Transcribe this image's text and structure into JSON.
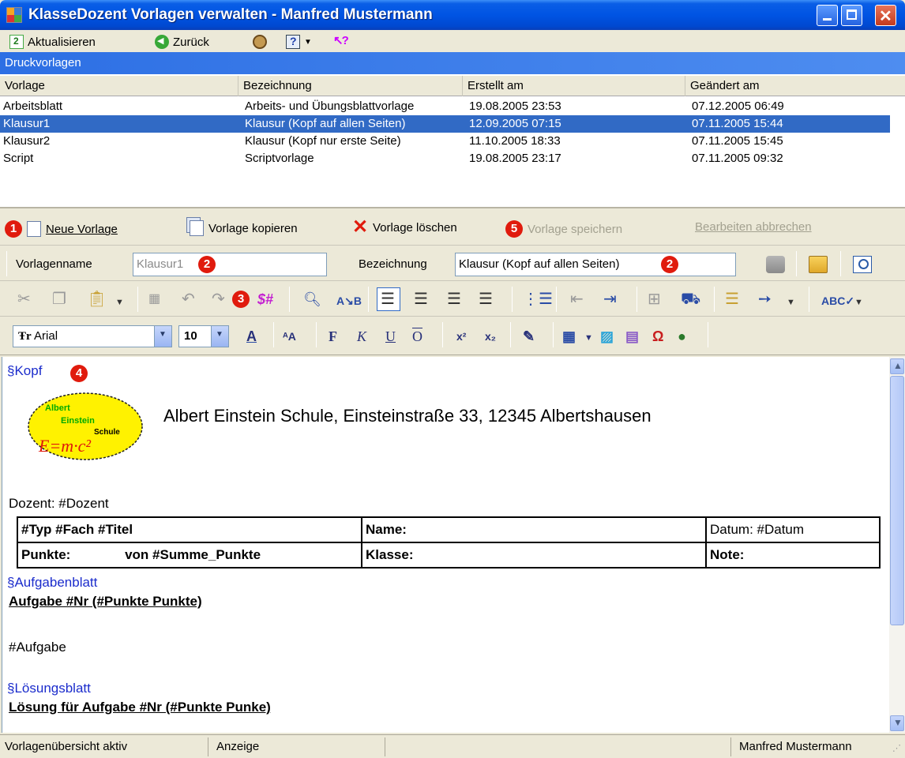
{
  "window": {
    "title": "KlasseDozent Vorlagen verwalten - Manfred Mustermann"
  },
  "main_toolbar": {
    "refresh_label": "Aktualisieren",
    "back_label": "Zurück"
  },
  "section": {
    "title": "Druckvorlagen"
  },
  "templates_list": {
    "columns": [
      "Vorlage",
      "Bezeichnung",
      "Erstellt am",
      "Geändert am"
    ],
    "rows": [
      {
        "vorlage": "Arbeitsblatt",
        "bezeichnung": "Arbeits- und Übungsblattvorlage",
        "erstellt": "19.08.2005 23:53",
        "geaendert": "07.12.2005 06:49",
        "selected": false
      },
      {
        "vorlage": "Klausur1",
        "bezeichnung": "Klausur (Kopf auf allen Seiten)",
        "erstellt": "12.09.2005 07:15",
        "geaendert": "07.11.2005 15:44",
        "selected": true
      },
      {
        "vorlage": "Klausur2",
        "bezeichnung": "Klausur (Kopf nur erste Seite)",
        "erstellt": "11.10.2005 18:33",
        "geaendert": "07.11.2005 15:45",
        "selected": false
      },
      {
        "vorlage": "Script",
        "bezeichnung": "Scriptvorlage",
        "erstellt": "19.08.2005 23:17",
        "geaendert": "07.11.2005 09:32",
        "selected": false
      }
    ]
  },
  "edit_toolbar": {
    "new_label": "Neue Vorlage",
    "copy_label": "Vorlage kopieren",
    "delete_label": "Vorlage löschen",
    "save_label": "Vorlage speichern",
    "cancel_label": "Bearbeiten abbrechen",
    "badge_new": "1",
    "badge_save": "5"
  },
  "name_row": {
    "name_label": "Vorlagenname",
    "name_value": "Klausur1",
    "desc_label": "Bezeichnung",
    "desc_value": "Klausur (Kopf auf allen Seiten)",
    "badge": "2"
  },
  "format_toolbar": {
    "badge": "3",
    "placeholder_glyph": "$#"
  },
  "font_toolbar": {
    "font_name": "Arial",
    "font_size": "10"
  },
  "editor": {
    "badge": "4",
    "section_kopf": "§Kopf",
    "logo_lines": [
      "Albert",
      "Einstein",
      "Schule",
      "E=m·c²"
    ],
    "school_line": "Albert Einstein Schule, Einsteinstraße 33, 12345 Albertshausen",
    "dozent_line": "Dozent: #Dozent",
    "table": {
      "r1c1": "#Typ #Fach #Titel",
      "r1c2": "Name:",
      "r1c3": "Datum: #Datum",
      "r2c1a": "Punkte:",
      "r2c1b": "von #Summe_Punkte",
      "r2c2": "Klasse:",
      "r2c3": "Note:"
    },
    "section_aufgabe": "§Aufgabenblatt",
    "aufgabe_heading": "Aufgabe #Nr (#Punkte Punkte)",
    "aufgabe_body": "#Aufgabe",
    "section_loesung": "§Lösungsblatt",
    "loesung_heading": "Lösung für Aufgabe #Nr (#Punkte Punke)"
  },
  "statusbar": {
    "panel1": "Vorlagenübersicht aktiv",
    "panel2": "Anzeige",
    "panel4": "Manfred Mustermann"
  }
}
